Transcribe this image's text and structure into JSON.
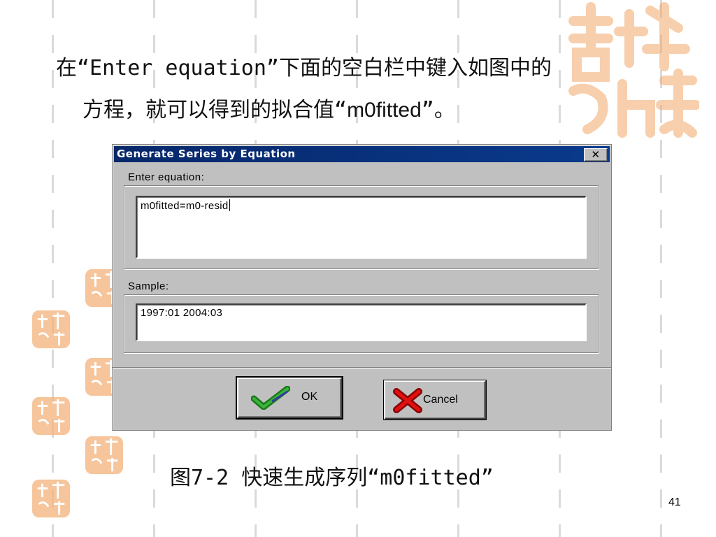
{
  "slide": {
    "heading_line1_prefix": "在“Enter equation”下面的空白栏中键入如图中的",
    "heading_line2_prefix": "方程，就可以得到的拟合值“",
    "heading_line2_var": "m0fitted",
    "heading_line2_suffix": "”。",
    "caption": "图7-2 快速生成序列“m0fitted”",
    "page_number": "41",
    "seal_color": "#f2a86a"
  },
  "dialog": {
    "title": "Generate Series by Equation",
    "close_glyph": "✕",
    "equation_label": "Enter equation:",
    "equation_value": "m0fitted=m0-resid",
    "sample_label": "Sample:",
    "sample_value": "1997:01 2004:03",
    "ok_label": "OK",
    "cancel_label": "Cancel",
    "title_bar_color": "#0a3a8c"
  }
}
